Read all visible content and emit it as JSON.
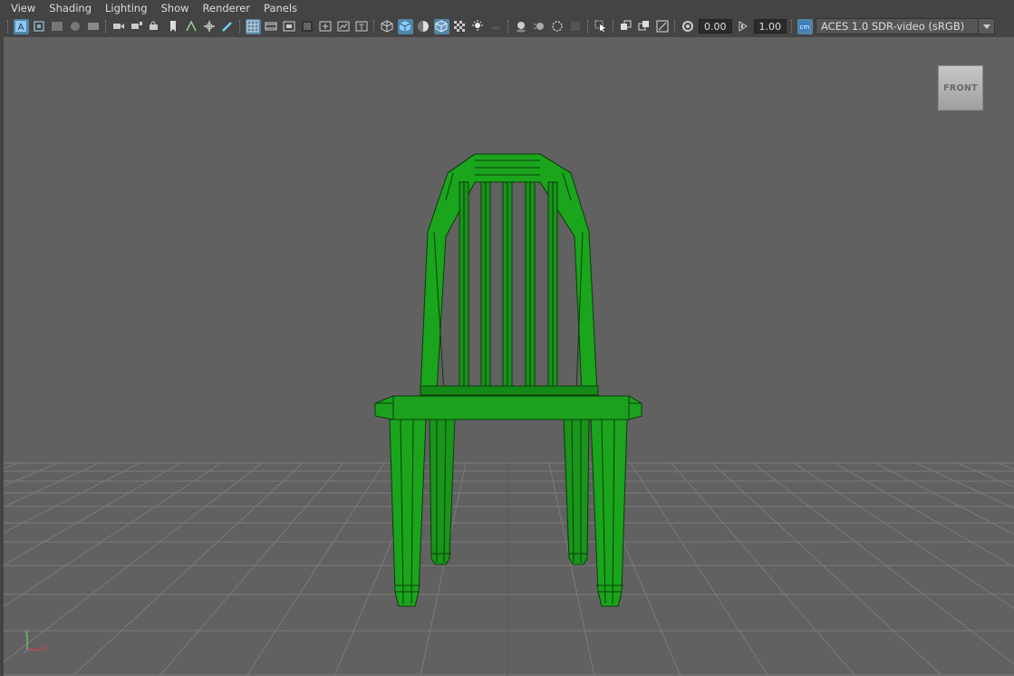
{
  "menu": [
    "View",
    "Shading",
    "Lighting",
    "Show",
    "Renderer",
    "Panels"
  ],
  "toolbar": {
    "field_gamma": "0.00",
    "field_exposure": "1.00",
    "color_space": "ACES 1.0 SDR-video (sRGB)"
  },
  "viewport": {
    "view_cube_label": "FRONT",
    "axis_y": "y",
    "axis_x": "x"
  },
  "colors": {
    "mesh_fill": "#1a9e1a",
    "mesh_wire": "#0a3d0a",
    "grid": "#7a7a7a",
    "active_icon": "#5285a6"
  }
}
